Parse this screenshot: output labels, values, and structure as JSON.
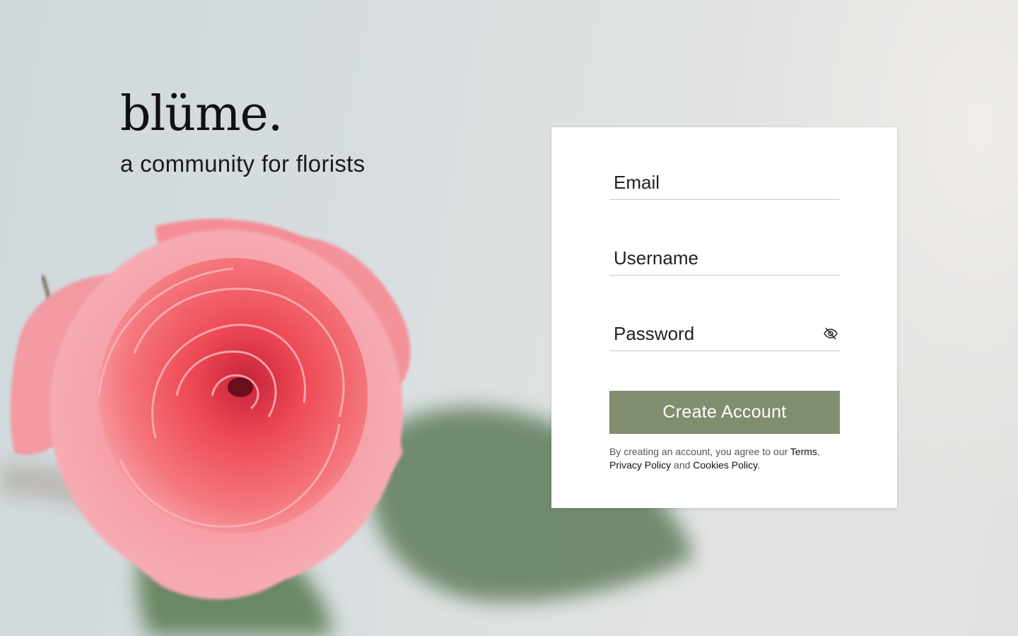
{
  "brand": {
    "logo": "blüme.",
    "tagline": "a community for florists"
  },
  "form": {
    "email_placeholder": "Email",
    "username_placeholder": "Username",
    "password_placeholder": "Password",
    "password_toggle_icon": "eye-off-icon",
    "submit_label": "Create Account"
  },
  "legal": {
    "prefix": "By creating an account, you agree to our ",
    "terms": "Terms",
    "comma": ",",
    "privacy": "Privacy Policy",
    "and": " and ",
    "cookies": "Cookies Policy",
    "period": "."
  },
  "colors": {
    "button": "#808d6e",
    "rose": "#ef5b64",
    "leaf": "#6c8a67"
  }
}
